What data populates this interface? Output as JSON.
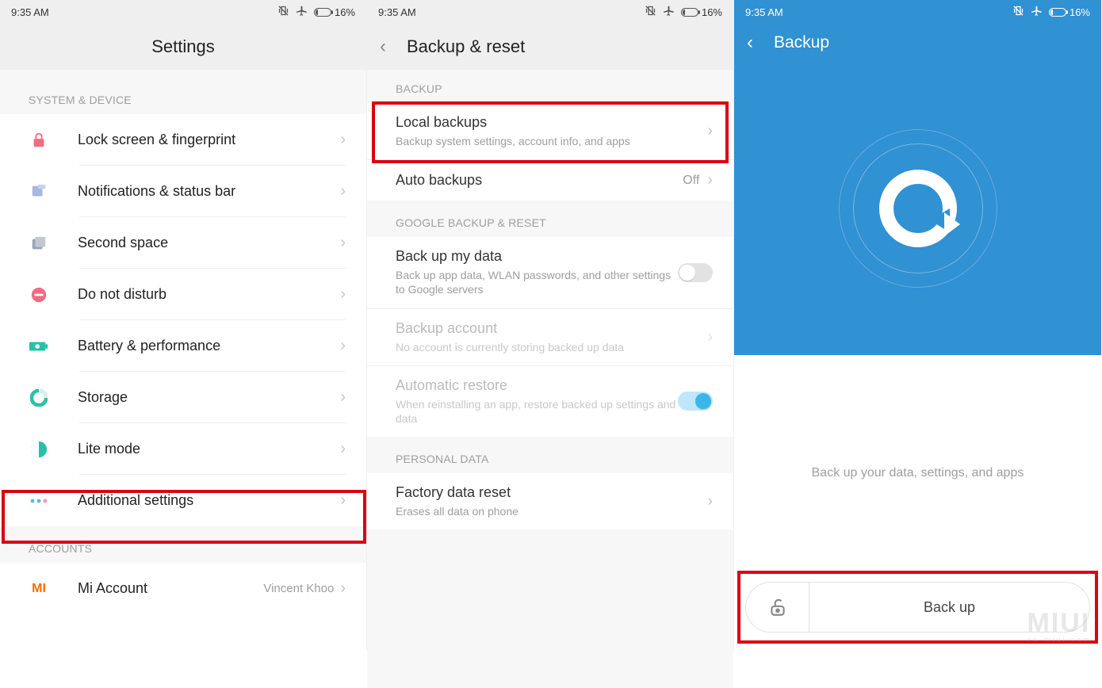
{
  "status": {
    "time": "9:35 AM",
    "battery_pct": "16%"
  },
  "screen1": {
    "title": "Settings",
    "section_system": "SYSTEM & DEVICE",
    "section_accounts": "ACCOUNTS",
    "items": {
      "lock": "Lock screen & fingerprint",
      "notif": "Notifications & status bar",
      "second": "Second space",
      "dnd": "Do not disturb",
      "battery": "Battery & performance",
      "storage": "Storage",
      "lite": "Lite mode",
      "additional": "Additional settings",
      "mi_account": "Mi Account",
      "mi_value": "Vincent Khoo"
    }
  },
  "screen2": {
    "title": "Backup & reset",
    "sec_backup": "BACKUP",
    "sec_google": "GOOGLE BACKUP & RESET",
    "sec_personal": "PERSONAL DATA",
    "local": "Local backups",
    "local_sub": "Backup system settings, account info, and apps",
    "auto": "Auto backups",
    "auto_val": "Off",
    "bmd": "Back up my data",
    "bmd_sub": "Back up app data, WLAN passwords, and other settings to Google servers",
    "bacct": "Backup account",
    "bacct_sub": "No account is currently storing backed up data",
    "arest": "Automatic restore",
    "arest_sub": "When reinstalling an app, restore backed up settings and data",
    "factory": "Factory data reset",
    "factory_sub": "Erases all data on phone"
  },
  "screen3": {
    "title": "Backup",
    "caption": "Back up your data, settings, and apps",
    "button": "Back up"
  },
  "watermark": {
    "big": "MIUI",
    "small": "en.miui.com"
  }
}
